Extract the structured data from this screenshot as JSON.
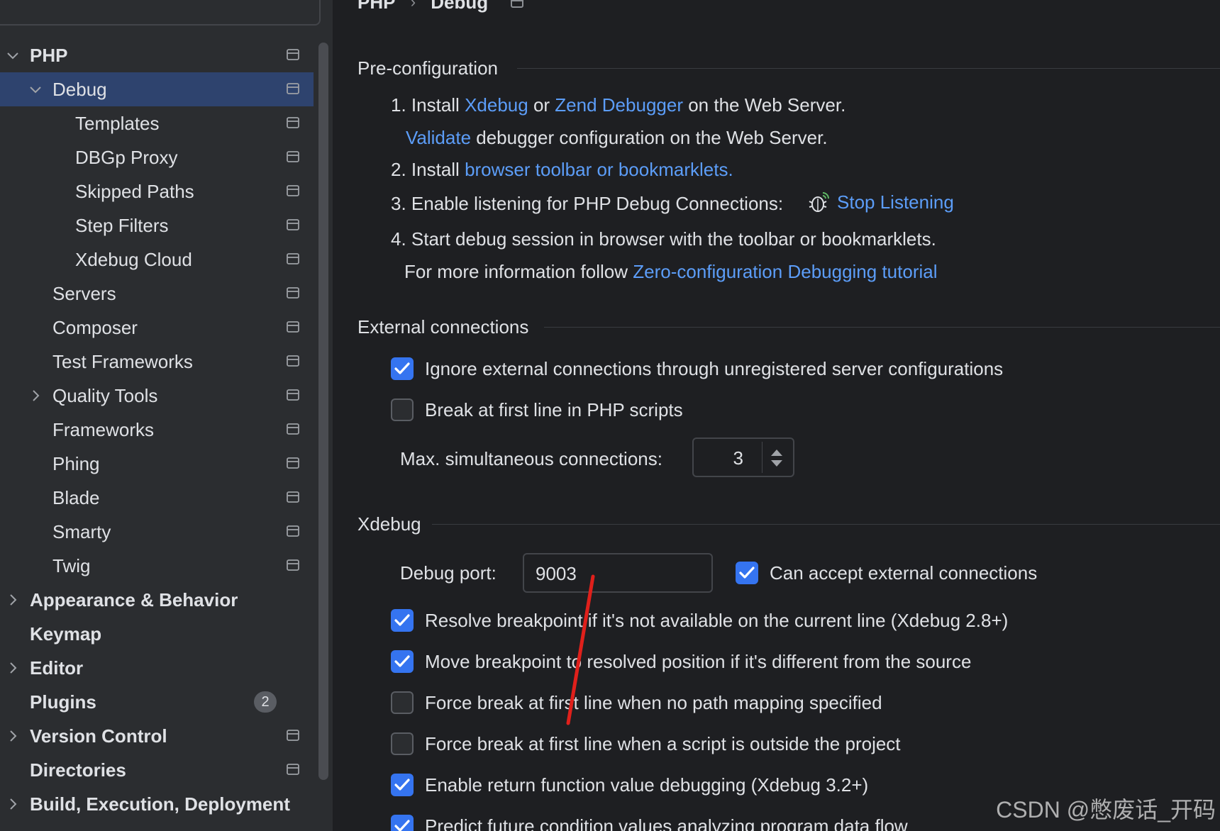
{
  "sidebar": {
    "search_placeholder": "",
    "tree": [
      {
        "label": "PHP",
        "bold": true,
        "expanded": true
      },
      {
        "label": "Debug",
        "selected": true,
        "expanded": true
      },
      {
        "label": "Templates"
      },
      {
        "label": "DBGp Proxy"
      },
      {
        "label": "Skipped Paths"
      },
      {
        "label": "Step Filters"
      },
      {
        "label": "Xdebug Cloud"
      },
      {
        "label": "Servers"
      },
      {
        "label": "Composer"
      },
      {
        "label": "Test Frameworks"
      },
      {
        "label": "Quality Tools",
        "collapsed": true
      },
      {
        "label": "Frameworks"
      },
      {
        "label": "Phing"
      },
      {
        "label": "Blade"
      },
      {
        "label": "Smarty"
      },
      {
        "label": "Twig"
      },
      {
        "label": "Appearance & Behavior",
        "bold": true,
        "collapsed": true
      },
      {
        "label": "Keymap",
        "bold": true
      },
      {
        "label": "Editor",
        "bold": true,
        "collapsed": true
      },
      {
        "label": "Plugins",
        "bold": true,
        "badge": "2"
      },
      {
        "label": "Version Control",
        "bold": true,
        "collapsed": true
      },
      {
        "label": "Directories",
        "bold": true
      },
      {
        "label": "Build, Execution, Deployment",
        "bold": true,
        "collapsed": true
      }
    ]
  },
  "breadcrumb": [
    "PHP",
    "Debug"
  ],
  "preconfig": {
    "title": "Pre-configuration",
    "step1_a": "1. Install ",
    "step1_link1": "Xdebug",
    "step1_b": " or ",
    "step1_link2": "Zend Debugger",
    "step1_c": " on the Web Server.",
    "validate_link": "Validate",
    "validate_text": " debugger configuration on the Web Server.",
    "step2_a": "2. Install ",
    "step2_link": "browser toolbar or bookmarklets.",
    "step3": "3. Enable listening for PHP Debug Connections:",
    "stop_listening": "Stop Listening",
    "step4": "4. Start debug session in browser with the toolbar or bookmarklets.",
    "more_info": "For more information follow ",
    "tutorial_link": "Zero-configuration Debugging tutorial"
  },
  "external": {
    "title": "External connections",
    "ignore_label": "Ignore external connections through unregistered server configurations",
    "ignore_checked": true,
    "break_first_label": "Break at first line in PHP scripts",
    "break_first_checked": false,
    "max_label": "Max. simultaneous connections:",
    "max_value": "3"
  },
  "xdebug": {
    "title": "Xdebug",
    "port_label": "Debug port:",
    "port_value": "9003",
    "accept_label": "Can accept external connections",
    "accept_checked": true,
    "options": [
      {
        "label": "Resolve breakpoint if it's not available on the current line (Xdebug 2.8+)",
        "checked": true
      },
      {
        "label": "Move breakpoint to resolved position if it's different from the source",
        "checked": true
      },
      {
        "label": "Force break at first line when no path mapping specified",
        "checked": false
      },
      {
        "label": "Force break at first line when a script is outside the project",
        "checked": false
      },
      {
        "label": "Enable return function value debugging (Xdebug 3.2+)",
        "checked": true
      },
      {
        "label": "Predict future condition values analyzing program data flow",
        "checked": true
      }
    ]
  },
  "watermark": "CSDN @憋废话_开码",
  "colors": {
    "link": "#5c9df8",
    "selected_row": "#2e436e",
    "checkbox": "#3574f0",
    "annotation": "#e0201b"
  }
}
